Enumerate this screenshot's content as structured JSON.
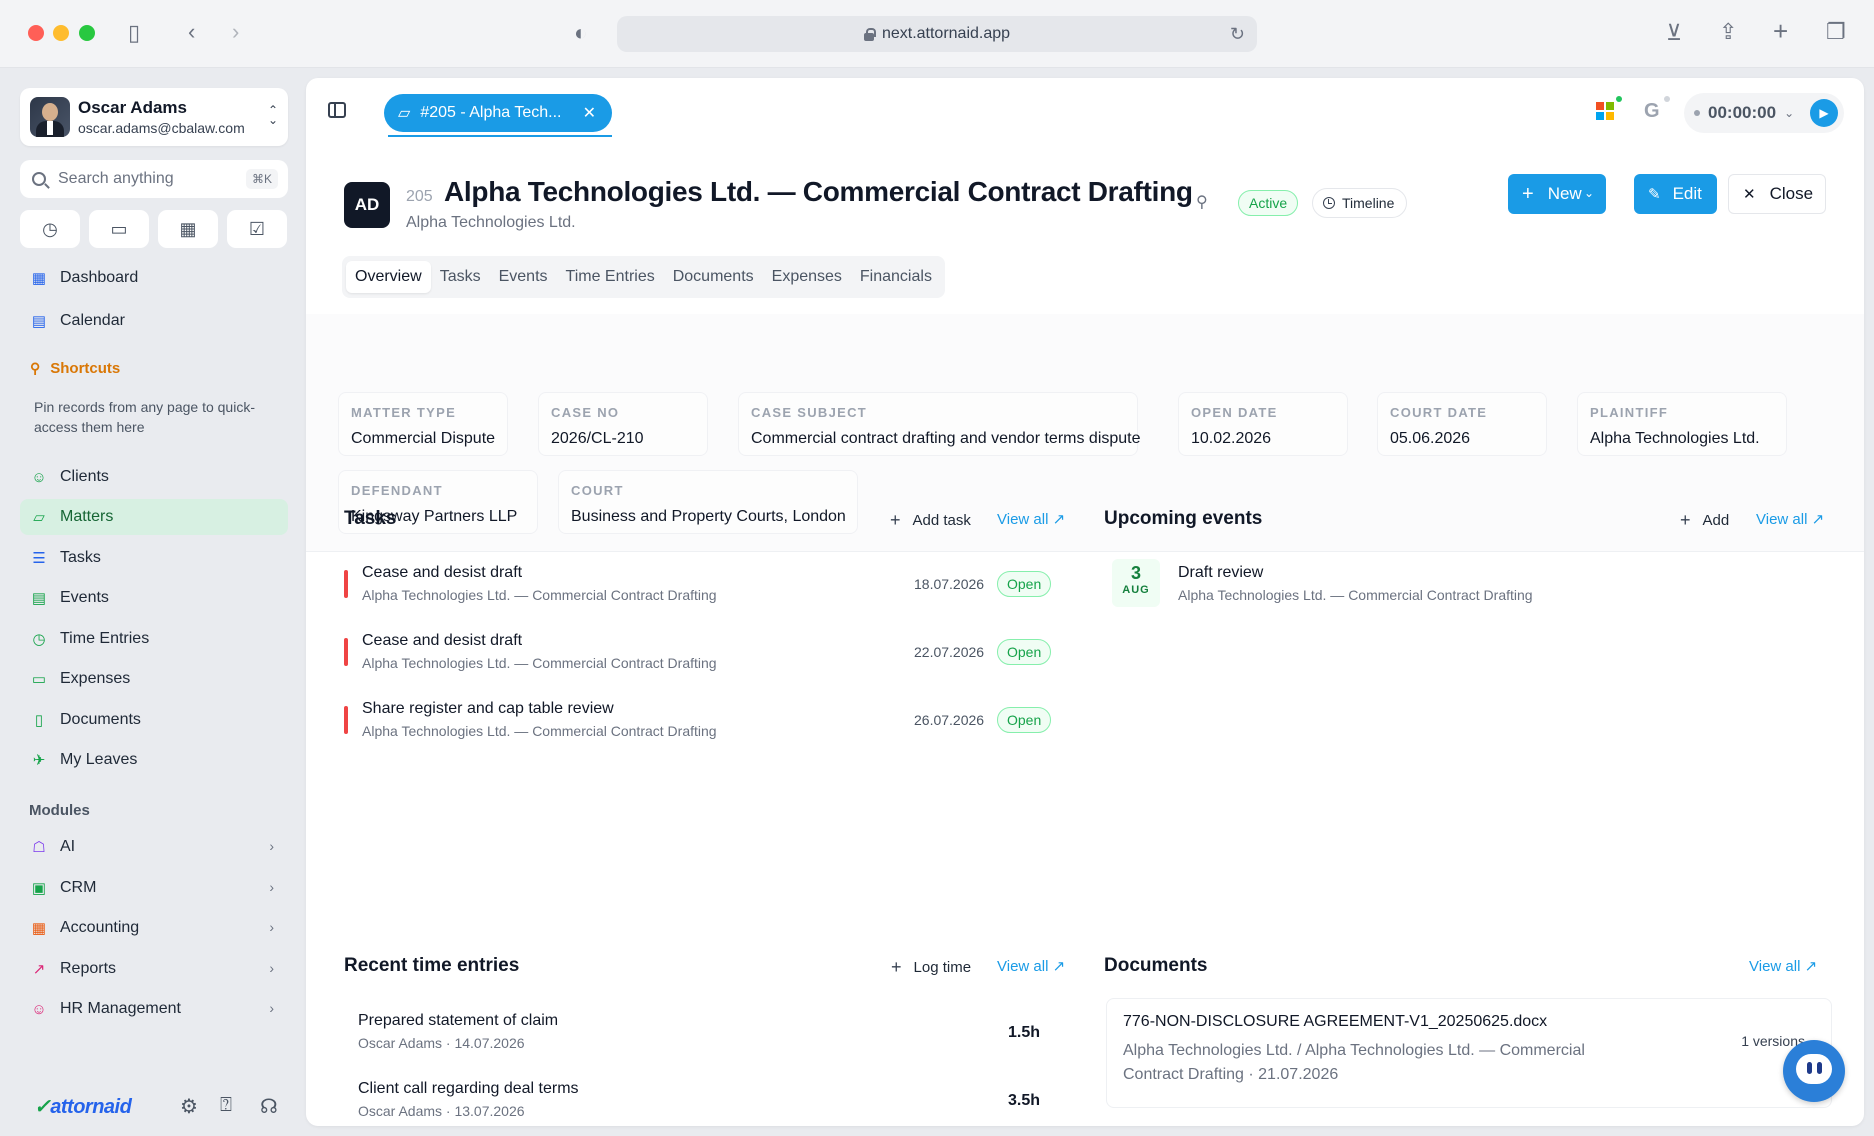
{
  "browser": {
    "url": "next.attornaid.app"
  },
  "user": {
    "name": "Oscar Adams",
    "email": "oscar.adams@cbalaw.com"
  },
  "search": {
    "placeholder": "Search anything",
    "shortcut": "⌘K"
  },
  "nav": {
    "dashboard": "Dashboard",
    "calendar": "Calendar",
    "shortcuts_title": "Shortcuts",
    "shortcuts_desc": "Pin records from any page to quick-access them here",
    "clients": "Clients",
    "matters": "Matters",
    "tasks": "Tasks",
    "events": "Events",
    "time_entries": "Time Entries",
    "expenses": "Expenses",
    "documents": "Documents",
    "my_leaves": "My Leaves",
    "modules_title": "Modules",
    "modules": [
      "AI",
      "CRM",
      "Accounting",
      "Reports",
      "HR Management"
    ]
  },
  "footer": {
    "logo": "attornaid"
  },
  "topbar": {
    "tab_label": "#205 - Alpha Tech...",
    "timer": "00:00:00"
  },
  "matter": {
    "initials": "AD",
    "number": "205",
    "title": "Alpha Technologies Ltd. — Commercial Contract Drafting",
    "client": "Alpha Technologies Ltd.",
    "status": "Active",
    "timeline_label": "Timeline",
    "new_label": "New",
    "edit_label": "Edit",
    "close_label": "Close"
  },
  "tabs": [
    "Overview",
    "Tasks",
    "Events",
    "Time Entries",
    "Documents",
    "Expenses",
    "Financials"
  ],
  "fields": {
    "matter_type": {
      "label": "Matter Type",
      "value": "Commercial Dispute"
    },
    "case_no": {
      "label": "Case No",
      "value": "2026/CL-210"
    },
    "case_subject": {
      "label": "Case Subject",
      "value": "Commercial contract drafting and vendor terms dispute"
    },
    "open_date": {
      "label": "Open Date",
      "value": "10.02.2026"
    },
    "court_date": {
      "label": "Court Date",
      "value": "05.06.2026"
    },
    "plaintiff": {
      "label": "Plaintiff",
      "value": "Alpha Technologies Ltd."
    },
    "defendant": {
      "label": "Defendant",
      "value": "Kingsway Partners LLP"
    },
    "court": {
      "label": "Court",
      "value": "Business and Property Courts, London"
    }
  },
  "tasks_section": {
    "title": "Tasks",
    "add_label": "Add task",
    "view_all": "View all ↗",
    "items": [
      {
        "title": "Cease and desist draft",
        "sub": "Alpha Technologies Ltd. — Commercial Contract Drafting",
        "date": "18.07.2026",
        "status": "Open"
      },
      {
        "title": "Cease and desist draft",
        "sub": "Alpha Technologies Ltd. — Commercial Contract Drafting",
        "date": "22.07.2026",
        "status": "Open"
      },
      {
        "title": "Share register and cap table review",
        "sub": "Alpha Technologies Ltd. — Commercial Contract Drafting",
        "date": "26.07.2026",
        "status": "Open"
      }
    ]
  },
  "events_section": {
    "title": "Upcoming events",
    "add_label": "Add",
    "view_all": "View all ↗",
    "items": [
      {
        "day": "3",
        "month": "AUG",
        "title": "Draft review",
        "sub": "Alpha Technologies Ltd. — Commercial Contract Drafting"
      }
    ]
  },
  "time_section": {
    "title": "Recent time entries",
    "add_label": "Log time",
    "view_all": "View all ↗",
    "items": [
      {
        "title": "Prepared statement of claim",
        "sub": "Oscar Adams · 14.07.2026",
        "hours": "1.5h"
      },
      {
        "title": "Client call regarding deal terms",
        "sub": "Oscar Adams · 13.07.2026",
        "hours": "3.5h"
      }
    ]
  },
  "documents_section": {
    "title": "Documents",
    "view_all": "View all ↗",
    "items": [
      {
        "title": "776-NON-DISCLOSURE AGREEMENT-V1_20250625.docx",
        "sub": "Alpha Technologies Ltd. / Alpha Technologies Ltd. — Commercial Contract Drafting · 21.07.2026",
        "versions": "1 versions"
      }
    ]
  }
}
